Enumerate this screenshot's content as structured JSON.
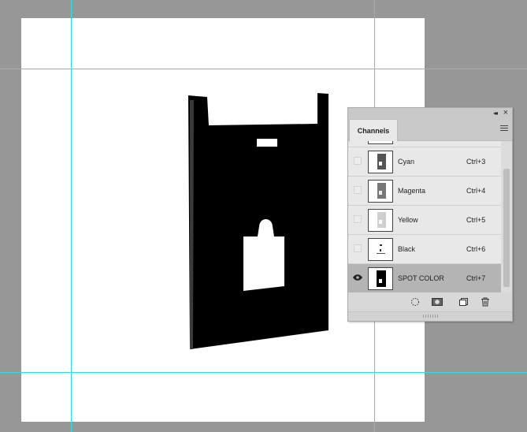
{
  "channels_panel": {
    "tab_label": "Channels",
    "channels": [
      {
        "name": "Cyan",
        "shortcut": "Ctrl+3",
        "visible": false,
        "selected": false,
        "thumb_icon": "cyan-channel-thumbnail"
      },
      {
        "name": "Magenta",
        "shortcut": "Ctrl+4",
        "visible": false,
        "selected": false,
        "thumb_icon": "magenta-channel-thumbnail"
      },
      {
        "name": "Yellow",
        "shortcut": "Ctrl+5",
        "visible": false,
        "selected": false,
        "thumb_icon": "yellow-channel-thumbnail"
      },
      {
        "name": "Black",
        "shortcut": "Ctrl+6",
        "visible": false,
        "selected": false,
        "thumb_icon": "black-channel-thumbnail"
      },
      {
        "name": "SPOT COLOR",
        "shortcut": "Ctrl+7",
        "visible": true,
        "selected": true,
        "thumb_icon": "spot-color-channel-thumbnail"
      }
    ],
    "bottom_buttons": [
      "load-selection-icon",
      "save-selection-as-channel-icon",
      "new-channel-icon",
      "delete-channel-icon"
    ]
  },
  "colors": {
    "workspace_bg": "#979797",
    "canvas_bg": "#ffffff",
    "guide": "#2fdede",
    "selected_row": "#b4b4b4"
  }
}
